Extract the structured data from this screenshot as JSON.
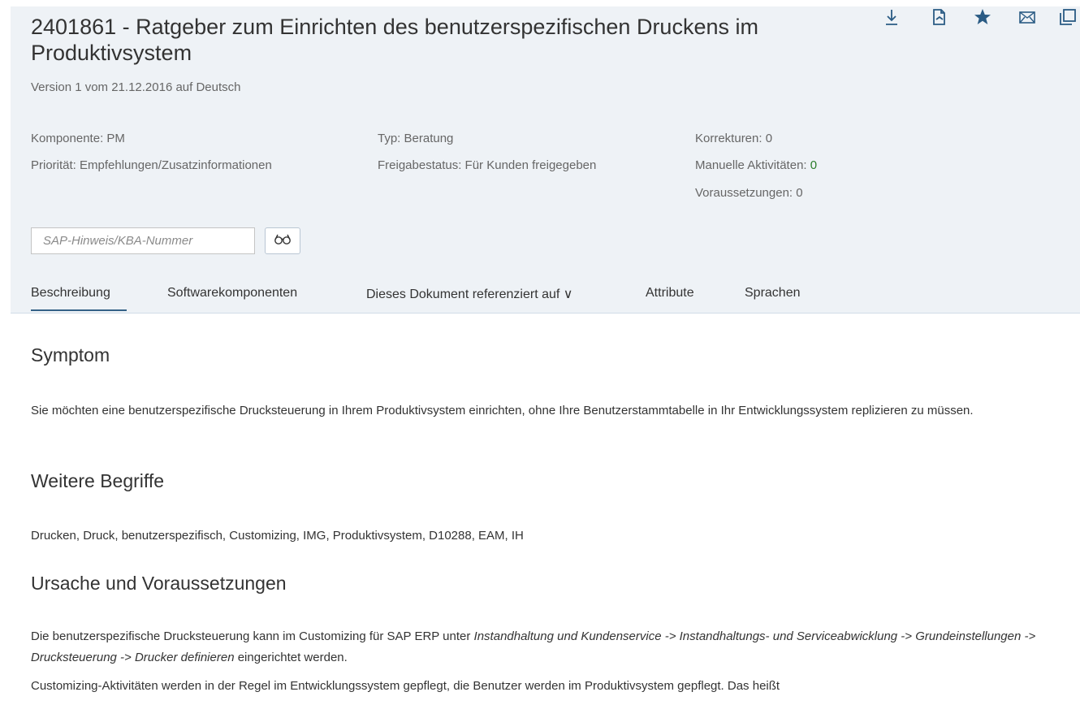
{
  "header": {
    "title": "2401861 - Ratgeber zum Einrichten des benutzerspezifischen Druckens im Produktivsystem",
    "version": "Version 1 vom 21.12.2016 auf Deutsch",
    "meta": {
      "komponente": "Komponente: PM",
      "prioritaet": "Priorität: Empfehlungen/Zusatzinformationen",
      "typ": "Typ: Beratung",
      "freigabestatus": "Freigabestatus: Für Kunden freigegeben",
      "korrekturen": "Korrekturen: 0",
      "manuelle_label": "Manuelle Aktivitäten: ",
      "manuelle_value": "0",
      "voraussetzungen": "Voraussetzungen: 0"
    },
    "icons": [
      "download-icon",
      "pdf-export-icon",
      "favorite-star-icon",
      "email-icon",
      "copy-icon"
    ]
  },
  "search": {
    "placeholder": "SAP-Hinweis/KBA-Nummer",
    "value": ""
  },
  "tabs": [
    {
      "label": "Beschreibung",
      "active": true
    },
    {
      "label": "Softwarekomponenten"
    },
    {
      "label": "Dieses Dokument referenziert auf ∨"
    },
    {
      "label": "Attribute"
    },
    {
      "label": "Sprachen"
    }
  ],
  "content": {
    "symptom_heading": "Symptom",
    "symptom_text": "Sie möchten eine benutzerspezifische Drucksteuerung in Ihrem Produktivsystem einrichten, ohne Ihre Benutzerstammtabelle in Ihr Entwicklungssystem replizieren zu müssen.",
    "begriffe_heading": "Weitere Begriffe",
    "begriffe_text": "Drucken, Druck, benutzerspezifisch, Customizing, IMG, Produktivsystem, D10288, EAM, IH",
    "ursache_heading": "Ursache und Voraussetzungen",
    "ursache_p1_a": "Die benutzerspezifische Drucksteuerung kann im Customizing für SAP ERP unter ",
    "ursache_p1_path": "Instandhaltung und Kundenservice -> Instandhaltungs- und Serviceabwicklung -> Grundeinstellungen -> Drucksteuerung -> Drucker definieren",
    "ursache_p1_b": " eingerichtet werden.",
    "ursache_p2": "Customizing-Aktivitäten werden in der Regel im Entwicklungssystem gepflegt, die Benutzer werden im Produktivsystem gepflegt. Das heißt"
  },
  "colors": {
    "header_bg": "#eef2f6",
    "accent": "#346187",
    "icon_blue": "#2a5b84",
    "green_value": "#2b7d2b"
  }
}
